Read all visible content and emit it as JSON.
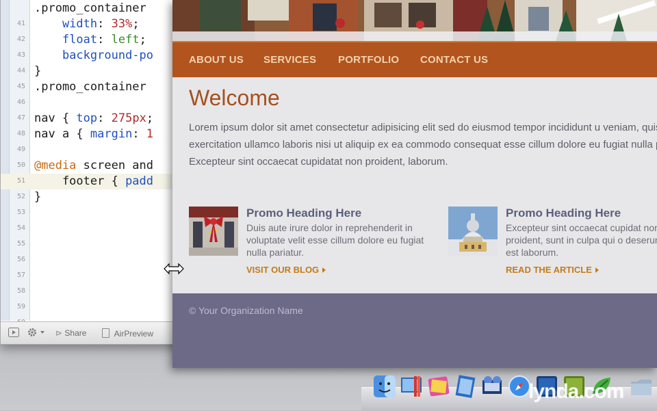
{
  "editor": {
    "lines": [
      {
        "n": "",
        "code": ".promo_container"
      },
      {
        "n": "41",
        "code": "    width: 33%;"
      },
      {
        "n": "42",
        "code": "    float: left;"
      },
      {
        "n": "43",
        "code": "    background-po"
      },
      {
        "n": "44",
        "code": "}"
      },
      {
        "n": "45",
        "code": ".promo_container"
      },
      {
        "n": "46",
        "code": ""
      },
      {
        "n": "47",
        "code": "nav { top: 275px;"
      },
      {
        "n": "48",
        "code": "nav a { margin: 1"
      },
      {
        "n": "49",
        "code": ""
      },
      {
        "n": "50",
        "code": "@media screen and"
      },
      {
        "n": "51",
        "code": "    footer { padd"
      },
      {
        "n": "52",
        "code": "}"
      },
      {
        "n": "53",
        "code": ""
      },
      {
        "n": "54",
        "code": ""
      },
      {
        "n": "55",
        "code": ""
      },
      {
        "n": "56",
        "code": ""
      },
      {
        "n": "57",
        "code": ""
      },
      {
        "n": "58",
        "code": ""
      },
      {
        "n": "59",
        "code": ""
      },
      {
        "n": "60",
        "code": ""
      }
    ],
    "status": {
      "share": "Share",
      "airpreview": "AirPreview"
    }
  },
  "site": {
    "nav": [
      "ABOUT US",
      "SERVICES",
      "PORTFOLIO",
      "CONTACT US"
    ],
    "heading": "Welcome",
    "body": "Lorem ipsum dolor sit amet consectetur adipisicing elit sed do eiusmod tempor incididunt u veniam, quis nostrud exercitation ullamco laboris nisi ut aliquip ex ea commodo consequat esse cillum dolore eu fugiat nulla pariatur. Excepteur sint occaecat cupidatat non proident, laborum.",
    "promos": [
      {
        "heading": "Promo Heading Here",
        "text": "Duis aute irure dolor in reprehenderit in voluptate velit esse cillum dolore eu fugiat nulla pariatur.",
        "link": "VISIT OUR BLOG"
      },
      {
        "heading": "Promo Heading Here",
        "text": "Excepteur sint occaecat cupidat non proident, sunt in culpa qui o deserunt mollit est laborum.",
        "link": "READ THE ARTICLE"
      }
    ],
    "footer": "© Your Organization Name"
  },
  "watermark": "lynda.com",
  "colors": {
    "nav": "#b2541d",
    "heading": "#a6501f",
    "footer": "#6c6a87",
    "link": "#c47a1a"
  }
}
